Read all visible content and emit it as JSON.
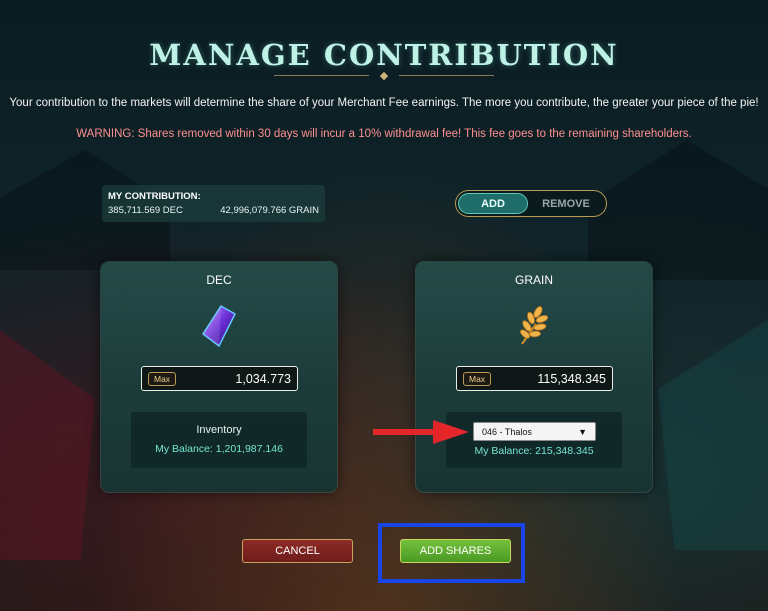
{
  "header": {
    "title": "MANAGE CONTRIBUTION",
    "intro": "Your contribution to the markets will determine the share of your Merchant Fee earnings. The more you contribute, the greater your piece of the pie!",
    "warning": "WARNING: Shares removed within 30 days will incur a 10% withdrawal fee! This fee goes to the remaining shareholders."
  },
  "contribution": {
    "label": "MY CONTRIBUTION:",
    "dec_amount": "385,711.569 DEC",
    "grain_amount": "42,996,079.766 GRAIN"
  },
  "mode_toggle": {
    "add_label": "ADD",
    "remove_label": "REMOVE",
    "active": "ADD"
  },
  "dec_panel": {
    "title": "DEC",
    "icon": "dec-crystal-icon",
    "max_label": "Max",
    "amount": "1,034.773",
    "source_label": "Inventory",
    "balance": "My Balance: 1,201,987.146"
  },
  "grain_panel": {
    "title": "GRAIN",
    "icon": "grain-wheat-icon",
    "max_label": "Max",
    "amount": "115,348.345",
    "source_select": "046 - Thalos",
    "balance": "My Balance: 215,348.345"
  },
  "actions": {
    "cancel_label": "CANCEL",
    "add_shares_label": "ADD SHARES"
  },
  "annotations": {
    "arrow_color": "#e3262a",
    "highlight_color": "#1a45e6"
  },
  "colors": {
    "title": "#bff2e6",
    "warning": "#ff8f8f",
    "balance": "#77e6d2",
    "cancel": "#8e2b27",
    "add": "#73c13a"
  }
}
